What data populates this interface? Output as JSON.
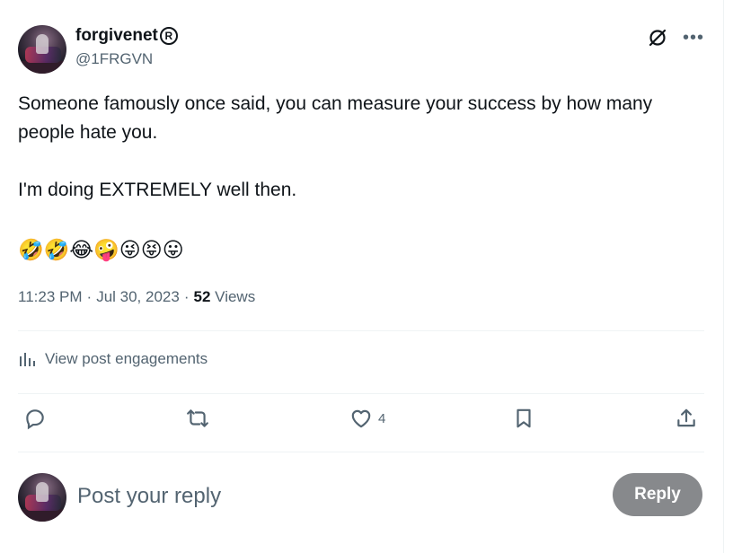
{
  "author": {
    "name": "forgivenet",
    "verified_mark": "R",
    "handle": "@1FRGVN"
  },
  "post": {
    "text": "Someone famously once said, you can measure your success by how many people hate you.\n\nI'm doing EXTREMELY well then.",
    "emojis": "🤣🤣😂🤪😜😝😛",
    "time": "11:23 PM",
    "separator": "·",
    "date": "Jul 30, 2023",
    "views_count": "52",
    "views_label": "Views"
  },
  "engagements": {
    "label": "View post engagements"
  },
  "actions": {
    "reply_count": "",
    "repost_count": "",
    "like_count": "4",
    "icons": [
      "reply-icon",
      "repost-icon",
      "like-icon",
      "bookmark-icon",
      "share-icon"
    ]
  },
  "reply": {
    "placeholder": "Post your reply",
    "button_label": "Reply"
  },
  "colors": {
    "text_primary": "#0f1419",
    "text_secondary": "#536471",
    "divider": "#eff3f4",
    "reply_button_disabled": "#87898c"
  }
}
